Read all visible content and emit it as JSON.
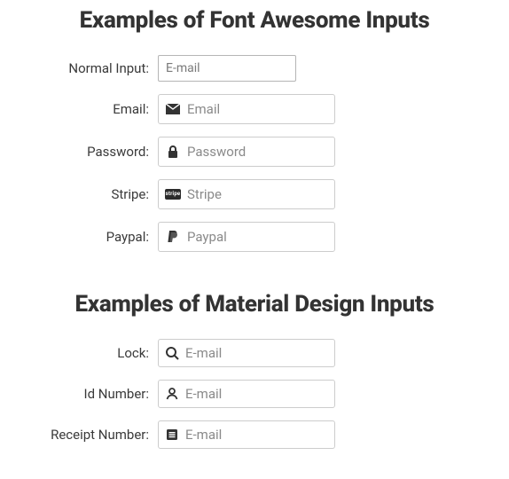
{
  "sections": {
    "fontAwesome": {
      "title": "Examples of Font Awesome Inputs",
      "rows": {
        "normal": {
          "label": "Normal Input:",
          "placeholder": "E-mail"
        },
        "email": {
          "label": "Email:",
          "placeholder": "Email"
        },
        "password": {
          "label": "Password:",
          "placeholder": "Password"
        },
        "stripe": {
          "label": "Stripe:",
          "placeholder": "Stripe",
          "badge": "stripe"
        },
        "paypal": {
          "label": "Paypal:",
          "placeholder": "Paypal"
        }
      }
    },
    "material": {
      "title": "Examples of Material Design Inputs",
      "rows": {
        "lock": {
          "label": "Lock:",
          "placeholder": "E-mail"
        },
        "id": {
          "label": "Id Number:",
          "placeholder": "E-mail"
        },
        "receipt": {
          "label": "Receipt Number:",
          "placeholder": "E-mail"
        }
      }
    }
  }
}
